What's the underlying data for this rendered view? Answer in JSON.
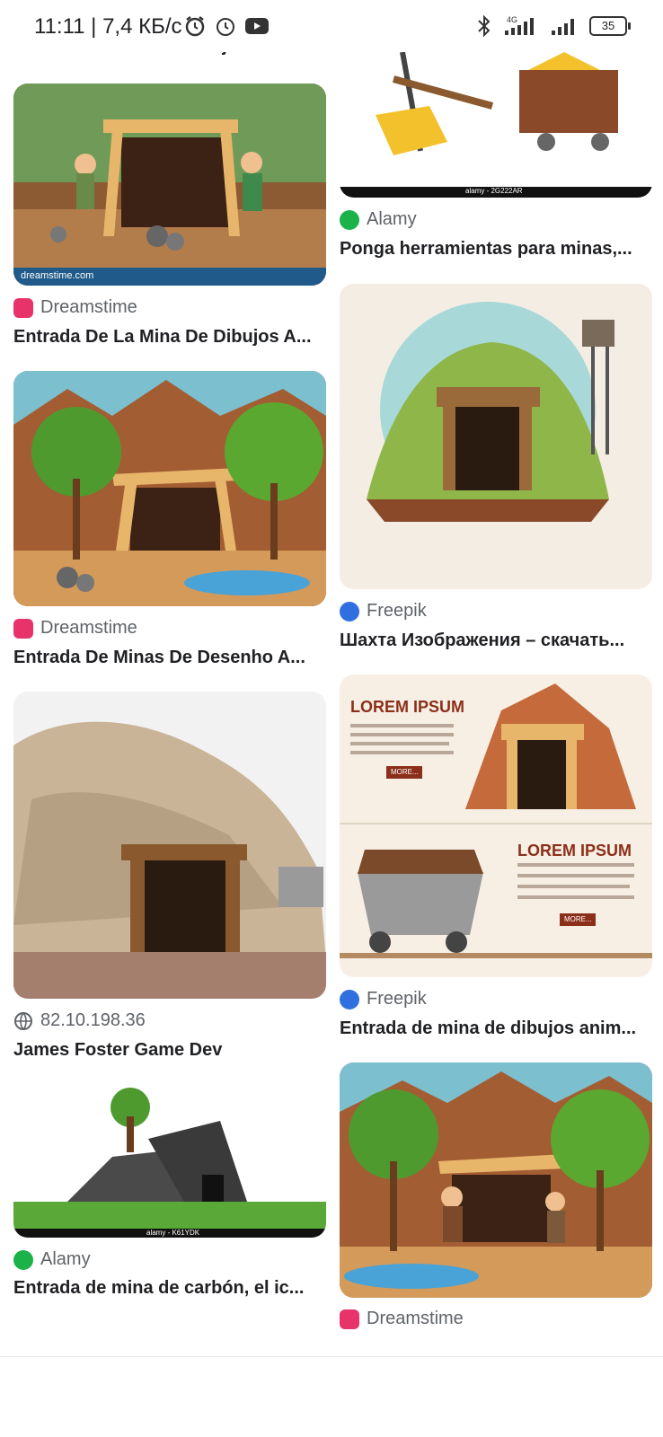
{
  "status_bar": {
    "time": "11:11",
    "speed": "7,4 КБ/с",
    "battery": "35",
    "network": "4G"
  },
  "top_partial_title": "Entrada de mina de dibujos anim...",
  "left": [
    {
      "source": "Dreamstime",
      "title": "Entrada De La Mina De Dibujos A...",
      "source_icon": "dreamstime-icon"
    },
    {
      "source": "Dreamstime",
      "title": "Entrada De Minas De Desenho A...",
      "source_icon": "dreamstime-icon"
    },
    {
      "source": "82.10.198.36",
      "title": "James Foster Game Dev",
      "source_icon": "globe-icon"
    },
    {
      "source": "Alamy",
      "title": "Entrada de mina de carbón, el ic...",
      "source_icon": "alamy-icon"
    }
  ],
  "right": [
    {
      "source": "Alamy",
      "title": "Ponga herramientas para minas,...",
      "source_icon": "alamy-icon"
    },
    {
      "source": "Freepik",
      "title": "Шахта Изображения – скачать...",
      "source_icon": "freepik-icon"
    },
    {
      "source": "Freepik",
      "title": "Entrada de mina de dibujos anim...",
      "source_icon": "freepik-icon"
    },
    {
      "source": "Dreamstime",
      "title": "",
      "source_icon": "dreamstime-icon"
    }
  ],
  "image_texts": {
    "dreamstime_watermark": "dreamstime.com",
    "alamy_watermark_1": "alamy - 2G222AR",
    "lorem_1": "LOREM IPSUM",
    "lorem_2": "LOREM IPSUM",
    "more_1": "MORE...",
    "more_2": "MORE...",
    "alamy_watermark_2": "alamy - K61YDK"
  },
  "colors": {
    "dreamstime": "#e8336a",
    "alamy": "#1bb24a",
    "freepik": "#2f6fe0",
    "globe": "#5f6368"
  }
}
